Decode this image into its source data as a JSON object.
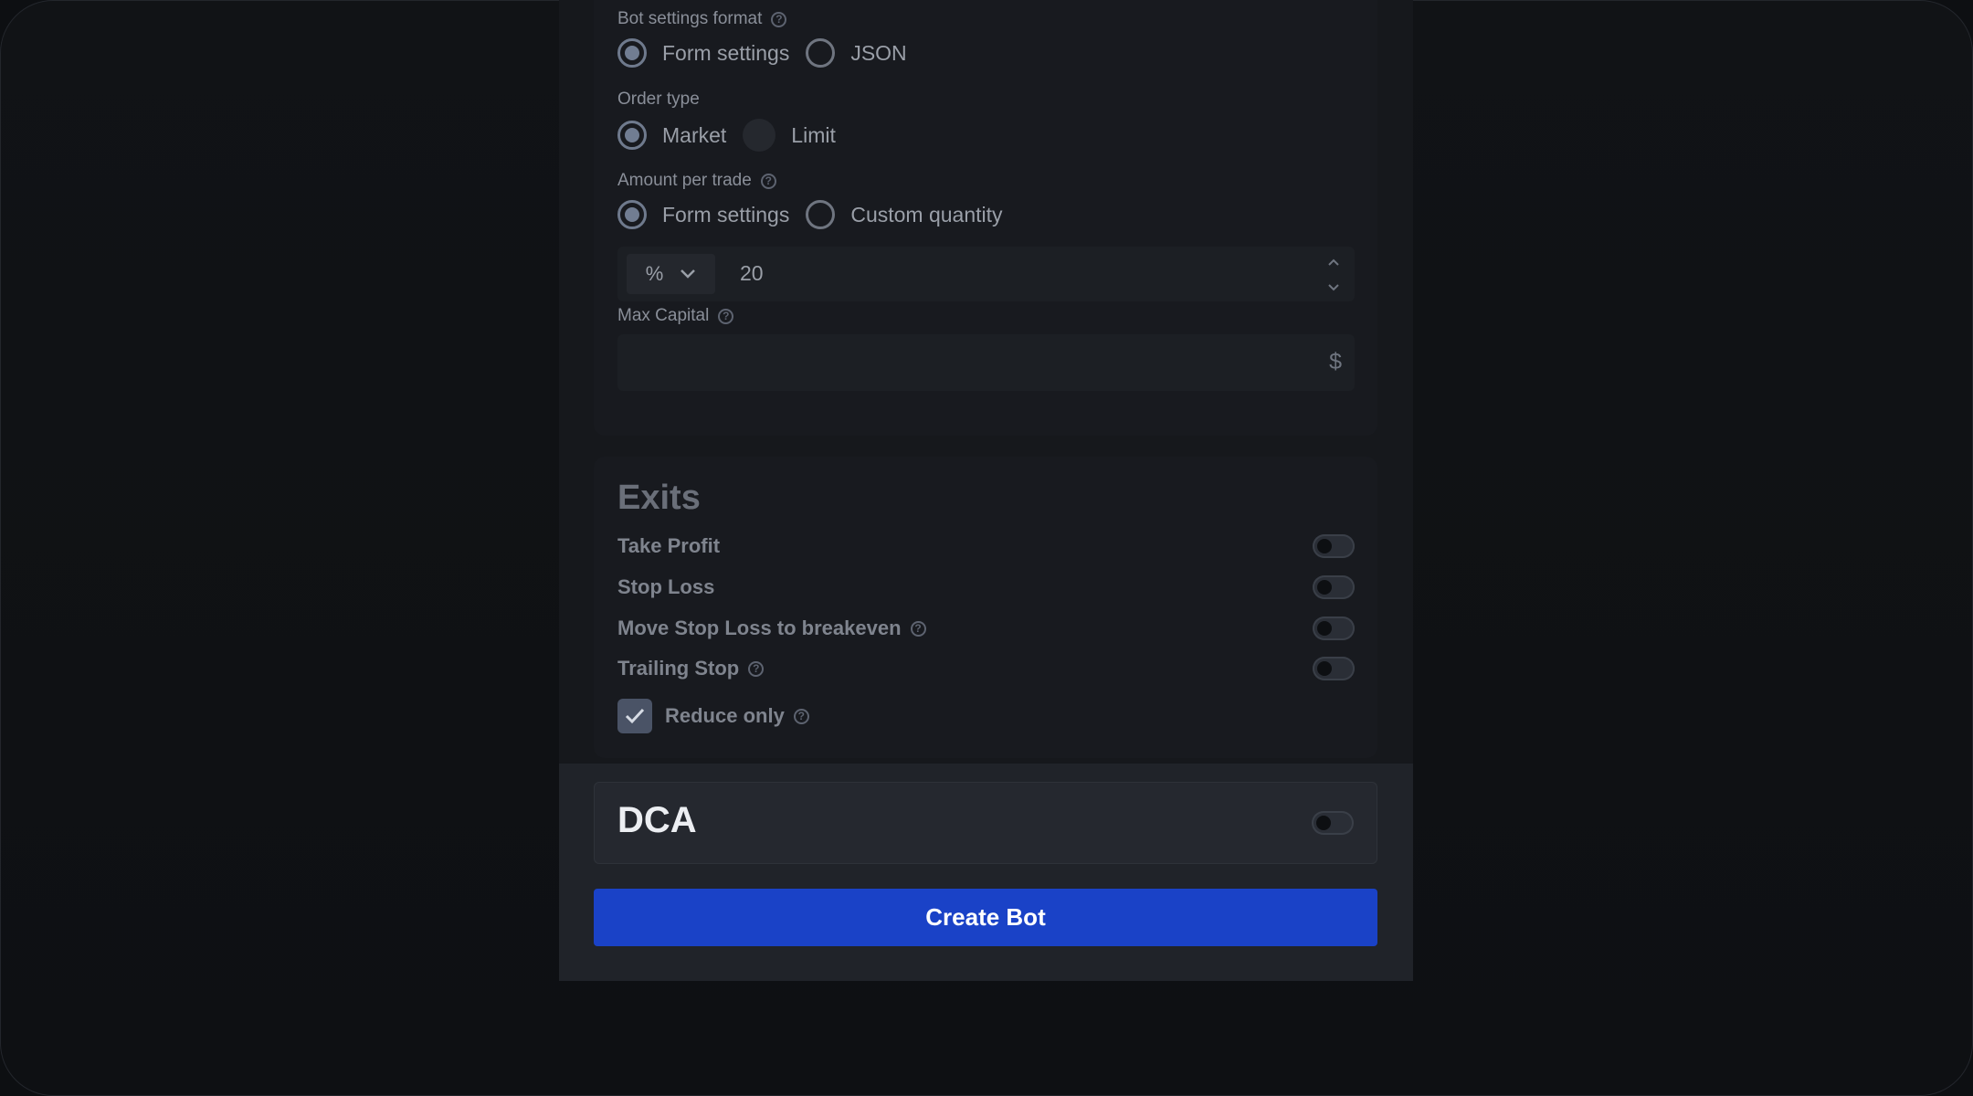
{
  "bot_settings_format": {
    "label": "Bot settings format",
    "options": [
      "Form settings",
      "JSON"
    ],
    "selected": "Form settings"
  },
  "order_type": {
    "label": "Order type",
    "options": [
      "Market",
      "Limit"
    ],
    "selected": "Market"
  },
  "amount_per_trade": {
    "label": "Amount per trade",
    "options": [
      "Form settings",
      "Custom quantity"
    ],
    "selected": "Form settings",
    "unit": "%",
    "value": "20"
  },
  "max_capital": {
    "label": "Max Capital",
    "value": "",
    "currency": "$"
  },
  "exits": {
    "title": "Exits",
    "items": [
      {
        "label": "Take Profit",
        "enabled": false,
        "help": false
      },
      {
        "label": "Stop Loss",
        "enabled": false,
        "help": false
      },
      {
        "label": "Move Stop Loss to breakeven",
        "enabled": false,
        "help": true
      },
      {
        "label": "Trailing Stop",
        "enabled": false,
        "help": true
      }
    ],
    "reduce_only": {
      "label": "Reduce only",
      "checked": true
    }
  },
  "dca": {
    "title": "DCA",
    "enabled": false
  },
  "actions": {
    "create_label": "Create Bot"
  },
  "help_glyph": "?",
  "colors": {
    "accent": "#1a42c7",
    "background": "#0d0f12",
    "panel": "#16181c"
  }
}
